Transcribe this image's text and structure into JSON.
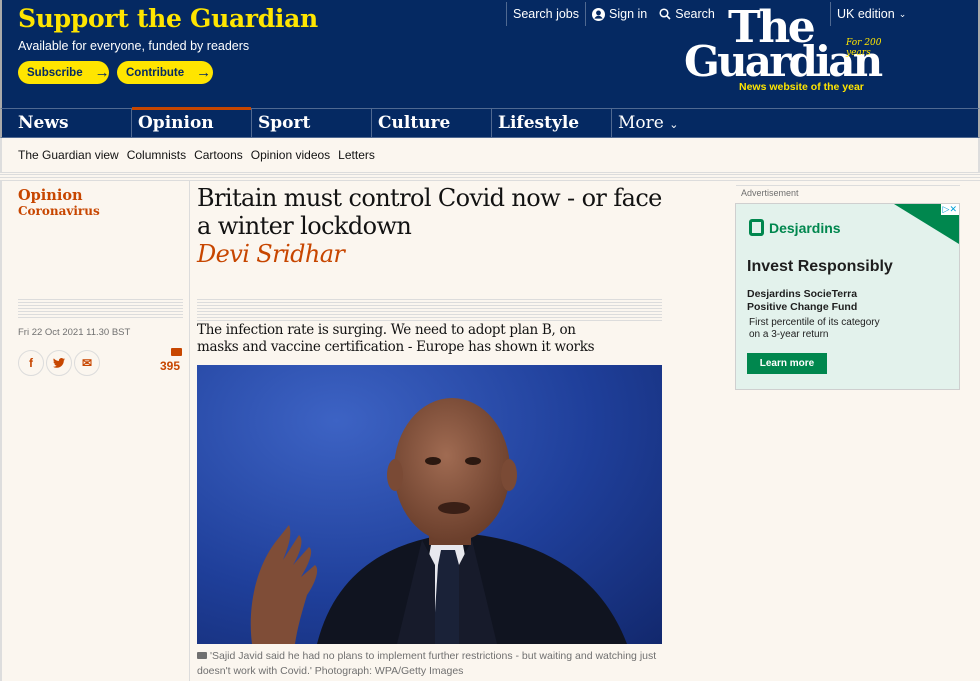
{
  "support": {
    "title": "Support the Guardian",
    "subtitle": "Available for everyone, funded by readers",
    "subscribe": "Subscribe",
    "contribute": "Contribute"
  },
  "top_links": {
    "search_jobs": "Search jobs",
    "sign_in": "Sign in",
    "search": "Search",
    "edition": "UK edition"
  },
  "logo": {
    "the": "The",
    "guardian": "Guardian",
    "for200": "For 200 years",
    "tagline": "News website of the year"
  },
  "nav": {
    "items": [
      "News",
      "Opinion",
      "Sport",
      "Culture",
      "Lifestyle",
      "More"
    ],
    "active": "Opinion"
  },
  "subnav": {
    "items": [
      "The Guardian view",
      "Columnists",
      "Cartoons",
      "Opinion videos",
      "Letters"
    ]
  },
  "article": {
    "section": "Opinion",
    "tag": "Coronavirus",
    "headline": "Britain must control Covid now - or face a winter lockdown",
    "byline": "Devi Sridhar",
    "dateline": "Fri 22 Oct 2021 11.30 BST",
    "comment_count": "395",
    "standfirst": "The infection rate is surging. We need to adopt plan B, on masks and vaccine certification - Europe has shown it works",
    "caption": "'Sajid Javid said he had no plans to implement further restrictions - but waiting and watching just doesn't work with Covid.' Photograph: WPA/Getty Images"
  },
  "share": {
    "facebook": "f",
    "twitter": "t",
    "email": "✉"
  },
  "ad": {
    "label": "Advertisement",
    "brand": "Desjardins",
    "headline": "Invest Responsibly",
    "fund_line1": "Desjardins SocieTerra",
    "fund_line2": "Positive Change Fund",
    "desc_line1": "First percentile of its category",
    "desc_line2": "on a 3-year return",
    "cta": "Learn more"
  },
  "colors": {
    "brand_blue": "#052962",
    "yellow": "#ffe500",
    "opinion_orange": "#c74600",
    "ad_green": "#00874e"
  }
}
